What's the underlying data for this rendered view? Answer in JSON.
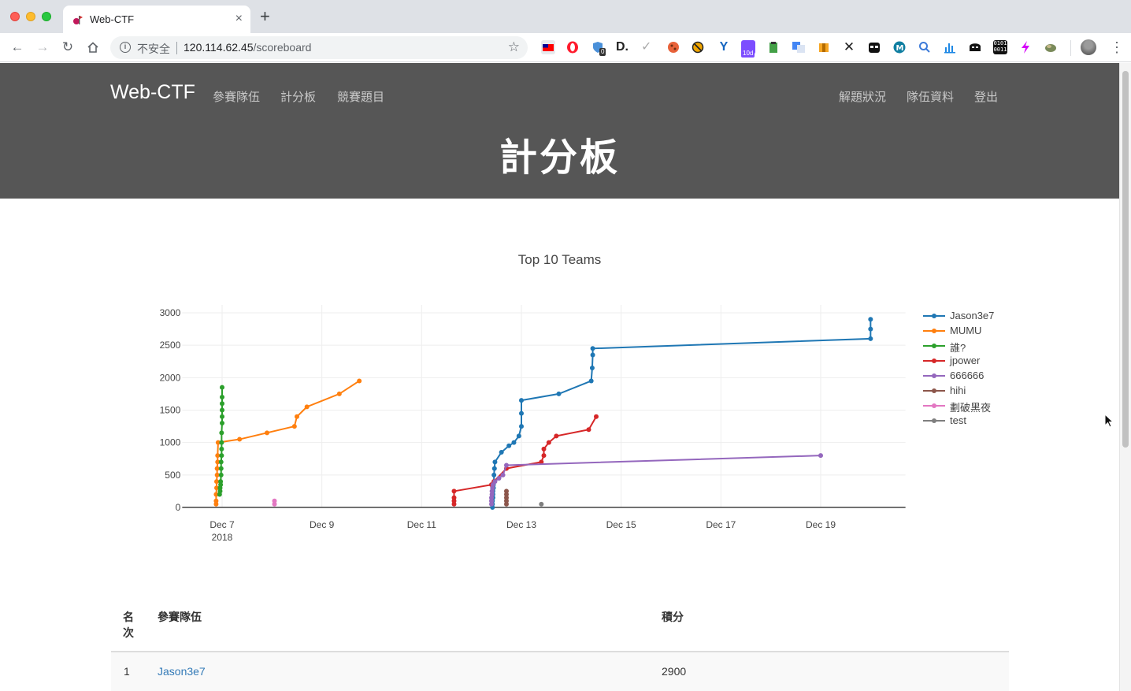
{
  "browser": {
    "tab_title": "Web-CTF",
    "tab_close": "×",
    "new_tab": "+",
    "security_label": "不安全",
    "url_host": "120.114.62.45",
    "url_path": "/scoreboard",
    "extension_badge": "0",
    "extension_badge_2": "10d",
    "extension_binary": "0101 0011"
  },
  "navbar": {
    "brand": "Web-CTF",
    "left_links": [
      "參賽隊伍",
      "計分板",
      "競賽題目"
    ],
    "right_links": [
      "解題狀況",
      "隊伍資料",
      "登出"
    ]
  },
  "page": {
    "heading": "計分板"
  },
  "chart_data": {
    "type": "line",
    "title": "Top 10 Teams",
    "xlabel": "",
    "ylabel": "",
    "ylim": [
      0,
      3000
    ],
    "yticks": [
      0,
      500,
      1000,
      1500,
      2000,
      2500,
      3000
    ],
    "xrange_days": [
      6.2,
      20.7
    ],
    "xticks": [
      {
        "day": 7,
        "label": "Dec 7",
        "sublabel": "2018"
      },
      {
        "day": 9,
        "label": "Dec 9"
      },
      {
        "day": 11,
        "label": "Dec 11"
      },
      {
        "day": 13,
        "label": "Dec 13"
      },
      {
        "day": 15,
        "label": "Dec 15"
      },
      {
        "day": 17,
        "label": "Dec 17"
      },
      {
        "day": 19,
        "label": "Dec 19"
      }
    ],
    "grid": true,
    "legend_position": "right",
    "series": [
      {
        "name": "Jason3e7",
        "color": "#1f77b4",
        "points": [
          [
            12.42,
            0
          ],
          [
            12.42,
            50
          ],
          [
            12.42,
            100
          ],
          [
            12.43,
            150
          ],
          [
            12.43,
            200
          ],
          [
            12.43,
            250
          ],
          [
            12.44,
            300
          ],
          [
            12.44,
            350
          ],
          [
            12.45,
            400
          ],
          [
            12.45,
            500
          ],
          [
            12.46,
            600
          ],
          [
            12.47,
            700
          ],
          [
            12.6,
            850
          ],
          [
            12.75,
            950
          ],
          [
            12.85,
            1000
          ],
          [
            12.95,
            1100
          ],
          [
            13.0,
            1250
          ],
          [
            13.0,
            1450
          ],
          [
            13.0,
            1650
          ],
          [
            13.75,
            1750
          ],
          [
            14.4,
            1950
          ],
          [
            14.42,
            2150
          ],
          [
            14.43,
            2350
          ],
          [
            14.43,
            2450
          ],
          [
            20.0,
            2600
          ],
          [
            20.0,
            2750
          ],
          [
            20.0,
            2900
          ]
        ]
      },
      {
        "name": "MUMU",
        "color": "#ff7f0e",
        "points": [
          [
            6.88,
            50
          ],
          [
            6.88,
            100
          ],
          [
            6.88,
            200
          ],
          [
            6.89,
            300
          ],
          [
            6.89,
            400
          ],
          [
            6.9,
            500
          ],
          [
            6.9,
            600
          ],
          [
            6.91,
            700
          ],
          [
            6.91,
            800
          ],
          [
            6.92,
            1000
          ],
          [
            7.35,
            1050
          ],
          [
            7.9,
            1150
          ],
          [
            8.45,
            1250
          ],
          [
            8.5,
            1400
          ],
          [
            8.7,
            1550
          ],
          [
            9.35,
            1750
          ],
          [
            9.75,
            1950
          ]
        ]
      },
      {
        "name": "誰?",
        "color": "#2ca02c",
        "points": [
          [
            6.95,
            200
          ],
          [
            6.96,
            250
          ],
          [
            6.96,
            300
          ],
          [
            6.97,
            350
          ],
          [
            6.97,
            400
          ],
          [
            6.98,
            500
          ],
          [
            6.98,
            600
          ],
          [
            6.98,
            700
          ],
          [
            6.99,
            800
          ],
          [
            6.99,
            900
          ],
          [
            6.99,
            1000
          ],
          [
            6.99,
            1150
          ],
          [
            7.0,
            1300
          ],
          [
            7.0,
            1400
          ],
          [
            7.0,
            1500
          ],
          [
            7.0,
            1600
          ],
          [
            7.0,
            1700
          ],
          [
            7.0,
            1850
          ]
        ]
      },
      {
        "name": "jpower",
        "color": "#d62728",
        "points": [
          [
            11.65,
            50
          ],
          [
            11.65,
            100
          ],
          [
            11.65,
            150
          ],
          [
            11.65,
            250
          ],
          [
            12.4,
            350
          ],
          [
            12.45,
            400
          ],
          [
            12.7,
            600
          ],
          [
            13.4,
            700
          ],
          [
            13.45,
            800
          ],
          [
            13.45,
            900
          ],
          [
            13.55,
            1000
          ],
          [
            13.7,
            1100
          ],
          [
            14.35,
            1200
          ],
          [
            14.5,
            1400
          ]
        ]
      },
      {
        "name": "666666",
        "color": "#9467bd",
        "points": [
          [
            12.4,
            50
          ],
          [
            12.4,
            100
          ],
          [
            12.4,
            150
          ],
          [
            12.41,
            200
          ],
          [
            12.41,
            250
          ],
          [
            12.42,
            300
          ],
          [
            12.43,
            350
          ],
          [
            12.47,
            400
          ],
          [
            12.55,
            450
          ],
          [
            12.63,
            500
          ],
          [
            12.7,
            650
          ],
          [
            19.0,
            800
          ]
        ]
      },
      {
        "name": "hihi",
        "color": "#8c564b",
        "points": [
          [
            12.7,
            50
          ],
          [
            12.7,
            100
          ],
          [
            12.7,
            150
          ],
          [
            12.7,
            200
          ],
          [
            12.7,
            250
          ]
        ]
      },
      {
        "name": "劃破黑夜",
        "color": "#e377c2",
        "points": [
          [
            8.05,
            50
          ],
          [
            8.05,
            100
          ]
        ]
      },
      {
        "name": "test",
        "color": "#7f7f7f",
        "points": [
          [
            13.4,
            50
          ]
        ]
      }
    ]
  },
  "table": {
    "headers": {
      "rank": "名次",
      "team": "參賽隊伍",
      "score": "積分"
    },
    "rows": [
      {
        "rank": "1",
        "team": "Jason3e7",
        "score": "2900"
      }
    ]
  }
}
